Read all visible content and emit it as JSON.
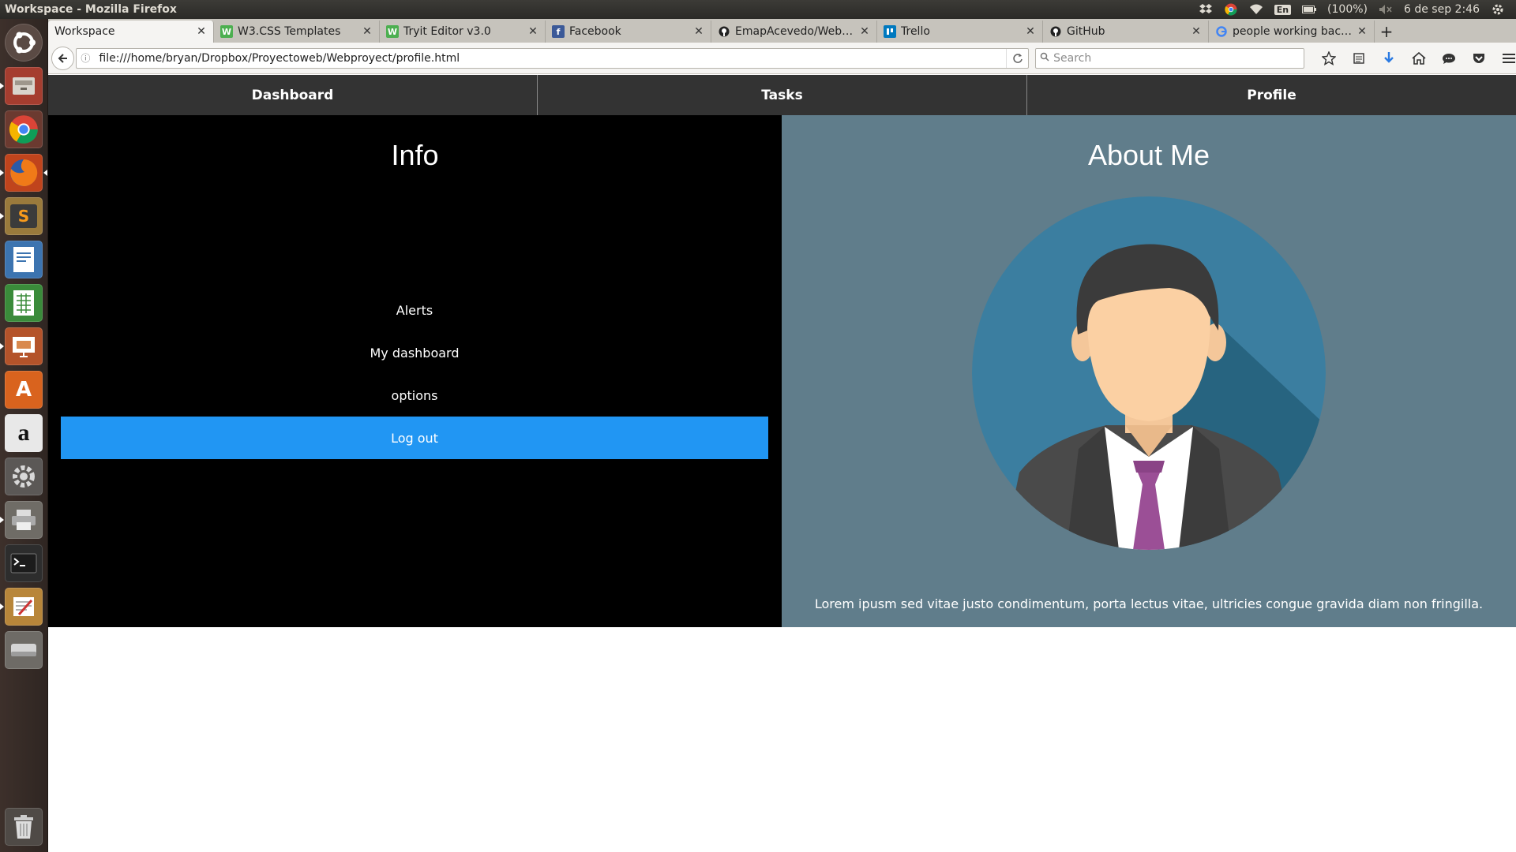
{
  "window": {
    "title": "Workspace - Mozilla Firefox"
  },
  "system_tray": {
    "language": "En",
    "battery": "(100%)",
    "datetime": "6 de sep  2:46"
  },
  "launcher": {
    "items": [
      {
        "name": "ubuntu-dash-icon"
      },
      {
        "name": "files-icon"
      },
      {
        "name": "chrome-icon"
      },
      {
        "name": "firefox-icon"
      },
      {
        "name": "sublime-text-icon"
      },
      {
        "name": "writer-icon"
      },
      {
        "name": "calc-icon"
      },
      {
        "name": "impress-icon"
      },
      {
        "name": "software-center-icon"
      },
      {
        "name": "amazon-icon"
      },
      {
        "name": "system-settings-icon"
      },
      {
        "name": "printer-icon"
      },
      {
        "name": "terminal-icon"
      },
      {
        "name": "text-editor-icon"
      },
      {
        "name": "drive-icon"
      },
      {
        "name": "trash-icon"
      }
    ]
  },
  "browser": {
    "tabs": [
      {
        "label": "Workspace",
        "favicon": "",
        "active": true
      },
      {
        "label": "W3.CSS Templates",
        "favicon": "W3"
      },
      {
        "label": "Tryit Editor v3.0",
        "favicon": "W3"
      },
      {
        "label": "Facebook",
        "favicon": "f"
      },
      {
        "label": "EmapAcevedo/Web…",
        "favicon": "gh"
      },
      {
        "label": "Trello",
        "favicon": "T"
      },
      {
        "label": "GitHub",
        "favicon": "gh"
      },
      {
        "label": "people working bac…",
        "favicon": "G"
      }
    ],
    "url": "file:///home/bryan/Dropbox/Proyectoweb/Webproyect/profile.html",
    "search_placeholder": "Search"
  },
  "page": {
    "nav": [
      "Dashboard",
      "Tasks",
      "Profile"
    ],
    "info": {
      "title": "Info",
      "menu": [
        "Alerts",
        "My dashboard",
        "options"
      ],
      "logout": "Log out"
    },
    "about": {
      "title": "About Me",
      "text": "Lorem ipusm sed vitae justo condimentum, porta lectus vitae, ultricies congue gravida diam non fringilla."
    }
  },
  "colors": {
    "nav_bg": "#333333",
    "info_bg": "#000000",
    "about_bg": "#607d8b",
    "logout_bg": "#2196f3"
  }
}
